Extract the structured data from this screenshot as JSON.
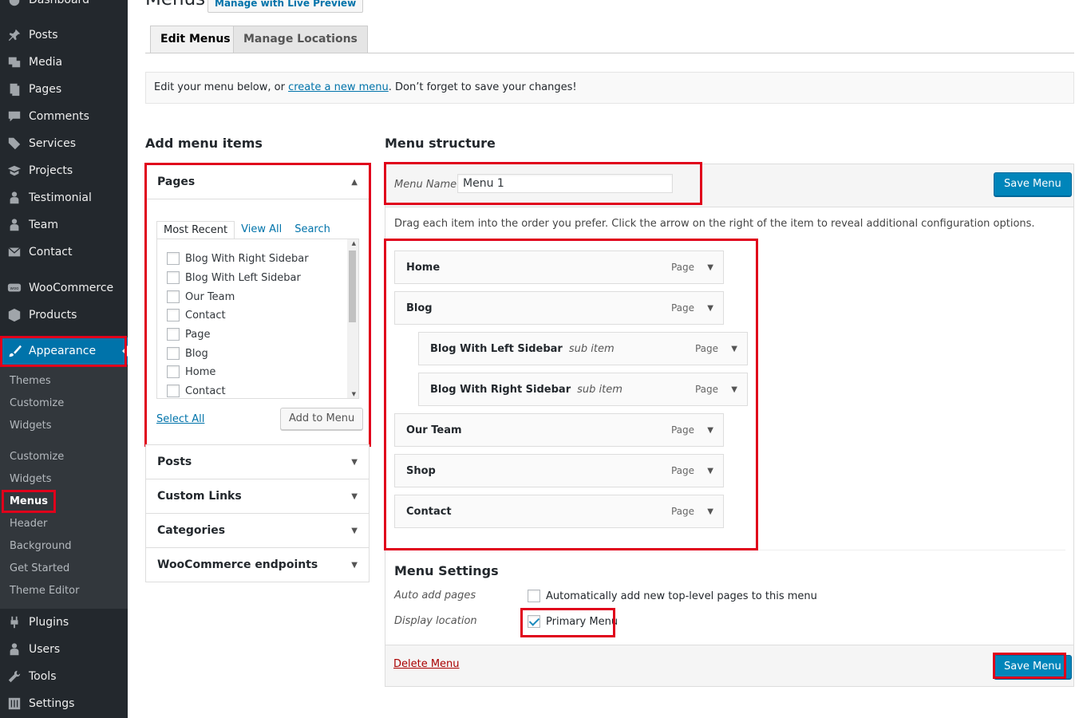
{
  "sidebar": {
    "top_item": "Dashboard",
    "items": [
      {
        "label": "Posts",
        "icon": "pin-icon"
      },
      {
        "label": "Media",
        "icon": "media-icon"
      },
      {
        "label": "Pages",
        "icon": "pages-icon"
      },
      {
        "label": "Comments",
        "icon": "comments-icon"
      },
      {
        "label": "Services",
        "icon": "tag-icon"
      },
      {
        "label": "Projects",
        "icon": "portfolio-icon"
      },
      {
        "label": "Testimonial",
        "icon": "person-icon"
      },
      {
        "label": "Team",
        "icon": "person-icon"
      },
      {
        "label": "Contact",
        "icon": "mail-icon"
      },
      {
        "label": "WooCommerce",
        "icon": "woo-icon"
      },
      {
        "label": "Products",
        "icon": "box-icon"
      },
      {
        "label": "Appearance",
        "icon": "brush-icon"
      }
    ],
    "submenu": [
      "Themes",
      "Customize",
      "Widgets",
      "Customize",
      "Widgets",
      "Menus",
      "Header",
      "Background",
      "Get Started",
      "Theme Editor"
    ],
    "bottom_items": [
      {
        "label": "Plugins",
        "icon": "plug-icon"
      },
      {
        "label": "Users",
        "icon": "person-icon"
      },
      {
        "label": "Tools",
        "icon": "wrench-icon"
      },
      {
        "label": "Settings",
        "icon": "settings-icon"
      }
    ]
  },
  "header": {
    "title": "Menus",
    "preview_button": "Manage with Live Preview",
    "tabs": [
      "Edit Menus",
      "Manage Locations"
    ]
  },
  "notice": {
    "before": "Edit your menu below, or ",
    "link": "create a new menu",
    "after": ". Don’t forget to save your changes!"
  },
  "add_items": {
    "heading": "Add menu items",
    "pages_panel": {
      "title": "Pages",
      "tabs": [
        "Most Recent",
        "View All",
        "Search"
      ],
      "items": [
        "Blog With Right Sidebar",
        "Blog With Left Sidebar",
        "Our Team",
        "Contact",
        "Page",
        "Blog",
        "Home",
        "Contact"
      ],
      "select_all": "Select All",
      "add_button": "Add to Menu"
    },
    "other_panels": [
      "Posts",
      "Custom Links",
      "Categories",
      "WooCommerce endpoints"
    ]
  },
  "structure": {
    "heading": "Menu structure",
    "menu_name_label": "Menu Name",
    "menu_name_value": "Menu 1",
    "save_label": "Save Menu",
    "instructions": "Drag each item into the order you prefer. Click the arrow on the right of the item to reveal additional configuration options.",
    "items": [
      {
        "title": "Home",
        "sub": "",
        "type": "Page"
      },
      {
        "title": "Blog",
        "sub": "",
        "type": "Page"
      },
      {
        "title": "Blog With Left Sidebar",
        "sub": "sub item",
        "type": "Page"
      },
      {
        "title": "Blog With Right Sidebar",
        "sub": "sub item",
        "type": "Page"
      },
      {
        "title": "Our Team",
        "sub": "",
        "type": "Page"
      },
      {
        "title": "Shop",
        "sub": "",
        "type": "Page"
      },
      {
        "title": "Contact",
        "sub": "",
        "type": "Page"
      }
    ],
    "settings": {
      "heading": "Menu Settings",
      "auto_add_label": "Auto add pages",
      "auto_add_text": "Automatically add new top-level pages to this menu",
      "auto_add_checked": false,
      "location_label": "Display location",
      "location_text": "Primary Menu",
      "location_checked": true
    },
    "delete_label": "Delete Menu"
  },
  "colors": {
    "sidebar_bg": "#23282d",
    "accent": "#0073aa",
    "highlight": "#e0001b"
  }
}
